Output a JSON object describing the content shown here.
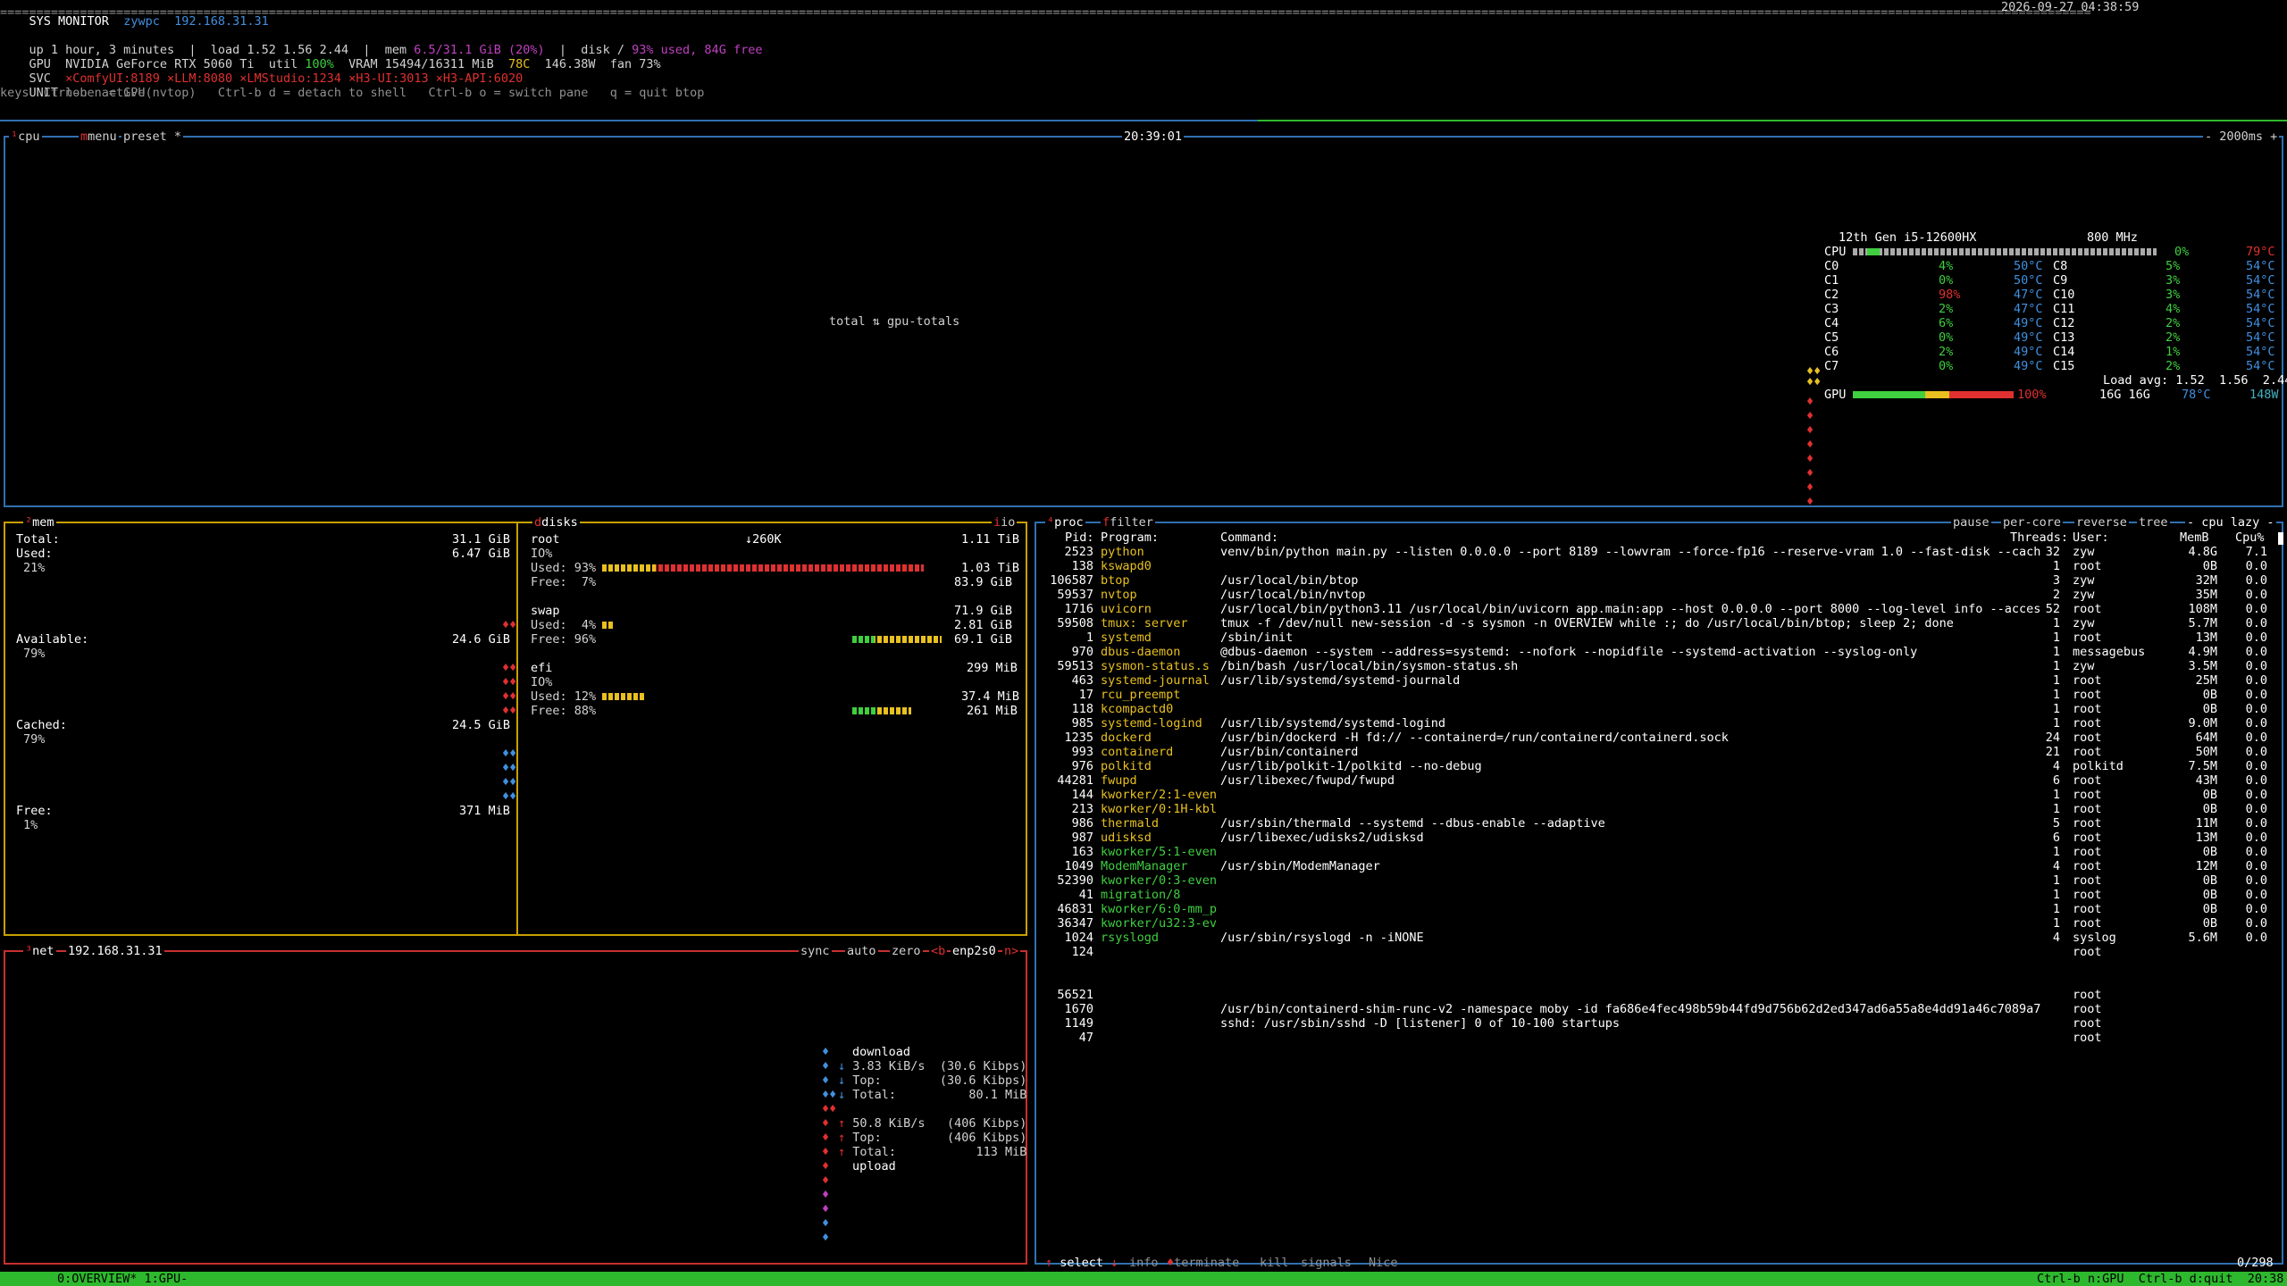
{
  "header": {
    "app_title": "SYS MONITOR",
    "host": "zywpc",
    "ip": "192.168.31.31",
    "datetime": "2026-09-27 04:38:59",
    "uptime_line": "up 1 hour, 3 minutes  |  load 1.52 1.56 2.44  |  mem ",
    "mem_used": "6.5/31.1 GiB (20%)",
    "disk_label": "  |  disk / ",
    "disk_used": "93% used, 84G free",
    "gpu_prefix": "GPU  NVIDIA GeForce RTX 5060 Ti  util ",
    "gpu_util": "100%",
    "gpu_vram": "  VRAM 15494/16311 MiB  ",
    "gpu_temp": "78C",
    "gpu_rest": "  146.38W  fan 73%",
    "svc_label": "SVC  ",
    "svc_items": [
      "×ComfyUI:8189",
      "×LLM:8080",
      "×LMStudio:1234",
      "×H3-UI:3013",
      "×H3-API:6020"
    ],
    "unit_label": "UNIT ",
    "unit_value": "none active",
    "keys_line": "keys  Ctrl-b n = GPU(nvtop)   Ctrl-b d = detach to shell   Ctrl-b o = switch pane   q = quit btop"
  },
  "cpu_box": {
    "tab_cpu": "cpu",
    "tab_menu": "menu",
    "tab_preset": "preset *",
    "clock": "20:39:01",
    "interval": "- 2000ms +",
    "center_label": "total ⇅ gpu-totals",
    "model": "12th Gen i5-12600HX",
    "freq": "800 MHz",
    "cpu_total_label": "CPU",
    "cpu_total_pct": "0%",
    "cpu_total_temp": "79°C",
    "cores_left": [
      {
        "name": "C0",
        "pct": "4%",
        "temp": "50°C"
      },
      {
        "name": "C1",
        "pct": "0%",
        "temp": "50°C"
      },
      {
        "name": "C2",
        "pct": "98%",
        "temp": "47°C"
      },
      {
        "name": "C3",
        "pct": "2%",
        "temp": "47°C"
      },
      {
        "name": "C4",
        "pct": "6%",
        "temp": "49°C"
      },
      {
        "name": "C5",
        "pct": "0%",
        "temp": "49°C"
      },
      {
        "name": "C6",
        "pct": "2%",
        "temp": "49°C"
      },
      {
        "name": "C7",
        "pct": "0%",
        "temp": "49°C"
      }
    ],
    "cores_right": [
      {
        "name": "C8",
        "pct": "5%",
        "temp": "54°C"
      },
      {
        "name": "C9",
        "pct": "3%",
        "temp": "54°C"
      },
      {
        "name": "C10",
        "pct": "3%",
        "temp": "54°C"
      },
      {
        "name": "C11",
        "pct": "4%",
        "temp": "54°C"
      },
      {
        "name": "C12",
        "pct": "2%",
        "temp": "54°C"
      },
      {
        "name": "C13",
        "pct": "2%",
        "temp": "54°C"
      },
      {
        "name": "C14",
        "pct": "1%",
        "temp": "54°C"
      },
      {
        "name": "C15",
        "pct": "2%",
        "temp": "54°C"
      }
    ],
    "load_avg": "Load avg: 1.52  1.56  2.44",
    "gpu_label": "GPU",
    "gpu_pct": "100%",
    "gpu_mem": "16G 16G",
    "gpu_temp": "78°C",
    "gpu_watt": "148W"
  },
  "mem_box": {
    "title": "mem",
    "total_label": "Total:",
    "total_value": "31.1 GiB",
    "used_label": "Used:",
    "used_value": "6.47 GiB",
    "used_pct": "21%",
    "avail_label": "Available:",
    "avail_value": "24.6 GiB",
    "avail_pct": "79%",
    "cached_label": "Cached:",
    "cached_value": "24.5 GiB",
    "cached_pct": "79%",
    "free_label": "Free:",
    "free_value": "371 MiB",
    "free_pct": "1%"
  },
  "disks_box": {
    "title": "disks",
    "io_tab": "io",
    "io_speed": "↓260K",
    "root_name": "root",
    "root_size": "1.11 TiB",
    "root_io": "IO%",
    "root_used": "Used: 93%",
    "root_used_val": "1.03 TiB",
    "root_used_frac": 0.93,
    "root_free": "Free:  7%",
    "root_free_val": "83.9 GiB",
    "swap_name": "swap",
    "swap_size": "71.9 GiB",
    "swap_used": "Used:  4%",
    "swap_used_val": "2.81 GiB",
    "swap_used_frac": 0.04,
    "swap_free": "Free: 96%",
    "swap_free_val": "69.1 GiB",
    "efi_name": "efi",
    "efi_size": "299 MiB",
    "efi_io": "IO%",
    "efi_used": "Used: 12%",
    "efi_used_val": "37.4 MiB",
    "efi_used_frac": 0.12,
    "efi_free": "Free: 88%",
    "efi_free_val": "261 MiB"
  },
  "net_box": {
    "title": "net",
    "ip": "192.168.31.31",
    "tab_sync": "sync",
    "tab_auto": "auto",
    "tab_zero": "zero",
    "tab_b": "<b",
    "iface": "enp2s0",
    "tab_n": "n>",
    "download_label": "download",
    "down_rate": "3.83 KiB/s  (30.6 Kibps)",
    "down_top": "Top:        (30.6 Kibps)",
    "down_total": "Total:          80.1 MiB",
    "up_rate": "50.8 KiB/s   (406 Kibps)",
    "up_top": "Top:         (406 Kibps)",
    "up_total": "Total:           113 MiB",
    "upload_label": "upload"
  },
  "proc_box": {
    "title": "proc",
    "filter": "filter",
    "tab_pause": "pause",
    "tab_percore": "per-core",
    "tab_reverse": "reverse",
    "tab_tree": "tree",
    "sort": "- cpu lazy -",
    "col_pid": "Pid:",
    "col_program": "Program:",
    "col_command": "Command:",
    "col_threads": "Threads:",
    "col_user": "User:",
    "col_mem": "MemB",
    "col_cpu": "Cpu%",
    "rows": [
      {
        "pid": "2523",
        "prog": "python",
        "cmd": "venv/bin/python main.py --listen 0.0.0.0 --port 8189 --lowvram --force-fp16 --reserve-vram 1.0 --fast-disk --cach",
        "thr": "32",
        "user": "zyw",
        "mem": "4.8G",
        "cpu": "7.1",
        "pc": "y"
      },
      {
        "pid": "138",
        "prog": "kswapd0",
        "cmd": "",
        "thr": "1",
        "user": "root",
        "mem": "0B",
        "cpu": "0.0",
        "pc": "y"
      },
      {
        "pid": "106587",
        "prog": "btop",
        "cmd": "/usr/local/bin/btop",
        "thr": "3",
        "user": "zyw",
        "mem": "32M",
        "cpu": "0.0",
        "pc": "y"
      },
      {
        "pid": "59537",
        "prog": "nvtop",
        "cmd": "/usr/local/bin/nvtop",
        "thr": "2",
        "user": "zyw",
        "mem": "35M",
        "cpu": "0.0",
        "pc": "y"
      },
      {
        "pid": "1716",
        "prog": "uvicorn",
        "cmd": "/usr/local/bin/python3.11 /usr/local/bin/uvicorn app.main:app --host 0.0.0.0 --port 8000 --log-level info --acces",
        "thr": "52",
        "user": "root",
        "mem": "108M",
        "cpu": "0.0",
        "pc": "y"
      },
      {
        "pid": "59508",
        "prog": "tmux: server",
        "cmd": "tmux -f /dev/null new-session -d -s sysmon -n OVERVIEW while :; do /usr/local/bin/btop; sleep 2; done",
        "thr": "1",
        "user": "zyw",
        "mem": "5.7M",
        "cpu": "0.0",
        "pc": "y"
      },
      {
        "pid": "1",
        "prog": "systemd",
        "cmd": "/sbin/init",
        "thr": "1",
        "user": "root",
        "mem": "13M",
        "cpu": "0.0",
        "pc": "y"
      },
      {
        "pid": "970",
        "prog": "dbus-daemon",
        "cmd": "@dbus-daemon --system --address=systemd: --nofork --nopidfile --systemd-activation --syslog-only",
        "thr": "1",
        "user": "messagebus",
        "mem": "4.9M",
        "cpu": "0.0",
        "pc": "y"
      },
      {
        "pid": "59513",
        "prog": "sysmon-status.s",
        "cmd": "/bin/bash /usr/local/bin/sysmon-status.sh",
        "thr": "1",
        "user": "zyw",
        "mem": "3.5M",
        "cpu": "0.0",
        "pc": "y"
      },
      {
        "pid": "463",
        "prog": "systemd-journal",
        "cmd": "/usr/lib/systemd/systemd-journald",
        "thr": "1",
        "user": "root",
        "mem": "25M",
        "cpu": "0.0",
        "pc": "y"
      },
      {
        "pid": "17",
        "prog": "rcu_preempt",
        "cmd": "",
        "thr": "1",
        "user": "root",
        "mem": "0B",
        "cpu": "0.0",
        "pc": "y"
      },
      {
        "pid": "118",
        "prog": "kcompactd0",
        "cmd": "",
        "thr": "1",
        "user": "root",
        "mem": "0B",
        "cpu": "0.0",
        "pc": "y"
      },
      {
        "pid": "985",
        "prog": "systemd-logind",
        "cmd": "/usr/lib/systemd/systemd-logind",
        "thr": "1",
        "user": "root",
        "mem": "9.0M",
        "cpu": "0.0",
        "pc": "y"
      },
      {
        "pid": "1235",
        "prog": "dockerd",
        "cmd": "/usr/bin/dockerd -H fd:// --containerd=/run/containerd/containerd.sock",
        "thr": "24",
        "user": "root",
        "mem": "64M",
        "cpu": "0.0",
        "pc": "y"
      },
      {
        "pid": "993",
        "prog": "containerd",
        "cmd": "/usr/bin/containerd",
        "thr": "21",
        "user": "root",
        "mem": "50M",
        "cpu": "0.0",
        "pc": "y"
      },
      {
        "pid": "976",
        "prog": "polkitd",
        "cmd": "/usr/lib/polkit-1/polkitd --no-debug",
        "thr": "4",
        "user": "polkitd",
        "mem": "7.5M",
        "cpu": "0.0",
        "pc": "y"
      },
      {
        "pid": "44281",
        "prog": "fwupd",
        "cmd": "/usr/libexec/fwupd/fwupd",
        "thr": "6",
        "user": "root",
        "mem": "43M",
        "cpu": "0.0",
        "pc": "y"
      },
      {
        "pid": "144",
        "prog": "kworker/2:1-even",
        "cmd": "",
        "thr": "1",
        "user": "root",
        "mem": "0B",
        "cpu": "0.0",
        "pc": "y"
      },
      {
        "pid": "213",
        "prog": "kworker/0:1H-kbl",
        "cmd": "",
        "thr": "1",
        "user": "root",
        "mem": "0B",
        "cpu": "0.0",
        "pc": "y"
      },
      {
        "pid": "986",
        "prog": "thermald",
        "cmd": "/usr/sbin/thermald --systemd --dbus-enable --adaptive",
        "thr": "5",
        "user": "root",
        "mem": "11M",
        "cpu": "0.0",
        "pc": "y"
      },
      {
        "pid": "987",
        "prog": "udisksd",
        "cmd": "/usr/libexec/udisks2/udisksd",
        "thr": "6",
        "user": "root",
        "mem": "13M",
        "cpu": "0.0",
        "pc": "y"
      },
      {
        "pid": "163",
        "prog": "kworker/5:1-even",
        "cmd": "",
        "thr": "1",
        "user": "root",
        "mem": "0B",
        "cpu": "0.0",
        "pc": "g"
      },
      {
        "pid": "1049",
        "prog": "ModemManager",
        "cmd": "/usr/sbin/ModemManager",
        "thr": "4",
        "user": "root",
        "mem": "12M",
        "cpu": "0.0",
        "pc": "g"
      },
      {
        "pid": "52390",
        "prog": "kworker/0:3-even",
        "cmd": "",
        "thr": "1",
        "user": "root",
        "mem": "0B",
        "cpu": "0.0",
        "pc": "g"
      },
      {
        "pid": "41",
        "prog": "migration/8",
        "cmd": "",
        "thr": "1",
        "user": "root",
        "mem": "0B",
        "cpu": "0.0",
        "pc": "g"
      },
      {
        "pid": "46831",
        "prog": "kworker/6:0-mm_p",
        "cmd": "",
        "thr": "1",
        "user": "root",
        "mem": "0B",
        "cpu": "0.0",
        "pc": "g"
      },
      {
        "pid": "36347",
        "prog": "kworker/u32:3-ev",
        "cmd": "",
        "thr": "1",
        "user": "root",
        "mem": "0B",
        "cpu": "0.0",
        "pc": "g"
      },
      {
        "pid": "1024",
        "prog": "rsyslogd",
        "cmd": "/usr/sbin/rsyslogd -n -iNONE",
        "thr": "4",
        "user": "syslog",
        "mem": "5.6M",
        "cpu": "0.0",
        "pc": "g"
      },
      {
        "pid": "124",
        "prog": "",
        "cmd": "",
        "thr": "",
        "user": "root",
        "mem": "",
        "cpu": "",
        "pc": "g"
      },
      {
        "pid": "",
        "prog": "",
        "cmd": "",
        "thr": "",
        "user": "",
        "mem": "",
        "cpu": "",
        "pc": "g"
      },
      {
        "pid": "",
        "prog": "",
        "cmd": "",
        "thr": "",
        "user": "",
        "mem": "",
        "cpu": "",
        "pc": "g"
      },
      {
        "pid": "56521",
        "prog": "",
        "cmd": "",
        "thr": "",
        "user": "root",
        "mem": "",
        "cpu": "",
        "pc": "g"
      },
      {
        "pid": "1670",
        "prog": "",
        "cmd": "/usr/bin/containerd-shim-runc-v2 -namespace moby -id fa686e4fec498b59b44fd9d756b62d2ed347ad6a55a8e4dd91a46c7089a7",
        "thr": "",
        "user": "root",
        "mem": "",
        "cpu": "",
        "pc": "g"
      },
      {
        "pid": "1149",
        "prog": "",
        "cmd": "sshd: /usr/sbin/sshd -D [listener] 0 of 10-100 startups",
        "thr": "",
        "user": "root",
        "mem": "",
        "cpu": "",
        "pc": "g"
      },
      {
        "pid": "47",
        "prog": "",
        "cmd": "",
        "thr": "",
        "user": "root",
        "mem": "",
        "cpu": "",
        "pc": "g"
      }
    ],
    "footer_select": "select",
    "footer_info": "info",
    "footer_terminate": "terminate",
    "footer_kill": "kill",
    "footer_signals": "signals",
    "footer_nice": "Nice",
    "footer_count": "0/298"
  },
  "tmux": {
    "session": "0:OVERVIEW* 1:GPU-",
    "right": "Ctrl-b n:GPU  Ctrl-b d:quit  20:38"
  },
  "colors": {
    "cpu_border": "#3070b0",
    "mem_border": "#c8a000",
    "net_border": "#c83030",
    "proc_border": "#3070b0",
    "tmux_bg": "#2eb82e"
  }
}
